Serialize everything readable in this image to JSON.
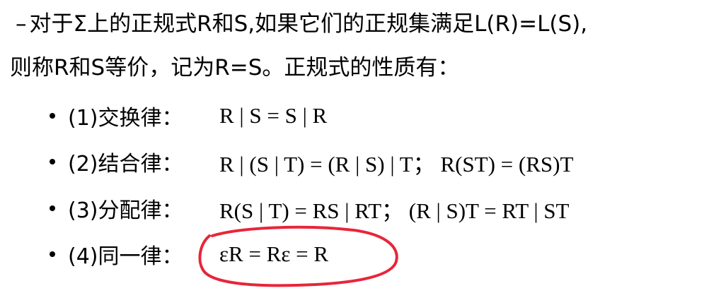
{
  "intro": {
    "dash": "–",
    "line1": "对于Σ上的正规式R和S,如果它们的正规集满足L(R)=L(S),",
    "line2": "则称R和S等价，记为R=S。正规式的性质有："
  },
  "laws": [
    {
      "label": "(1)交换律：",
      "formula": "R | S = S | R"
    },
    {
      "label": "(2)结合律：",
      "formula": "R | (S | T) = (R | S) | T；  R(ST) = (RS)T"
    },
    {
      "label": "(3)分配律：",
      "formula": "R(S | T) = RS | RT；  (R | S)T  =  RT | ST"
    },
    {
      "label": "(4)同一律：",
      "formula": "εR = Rε = R"
    }
  ],
  "highlight": {
    "color": "#e8253a",
    "target": "laws.3.formula"
  }
}
